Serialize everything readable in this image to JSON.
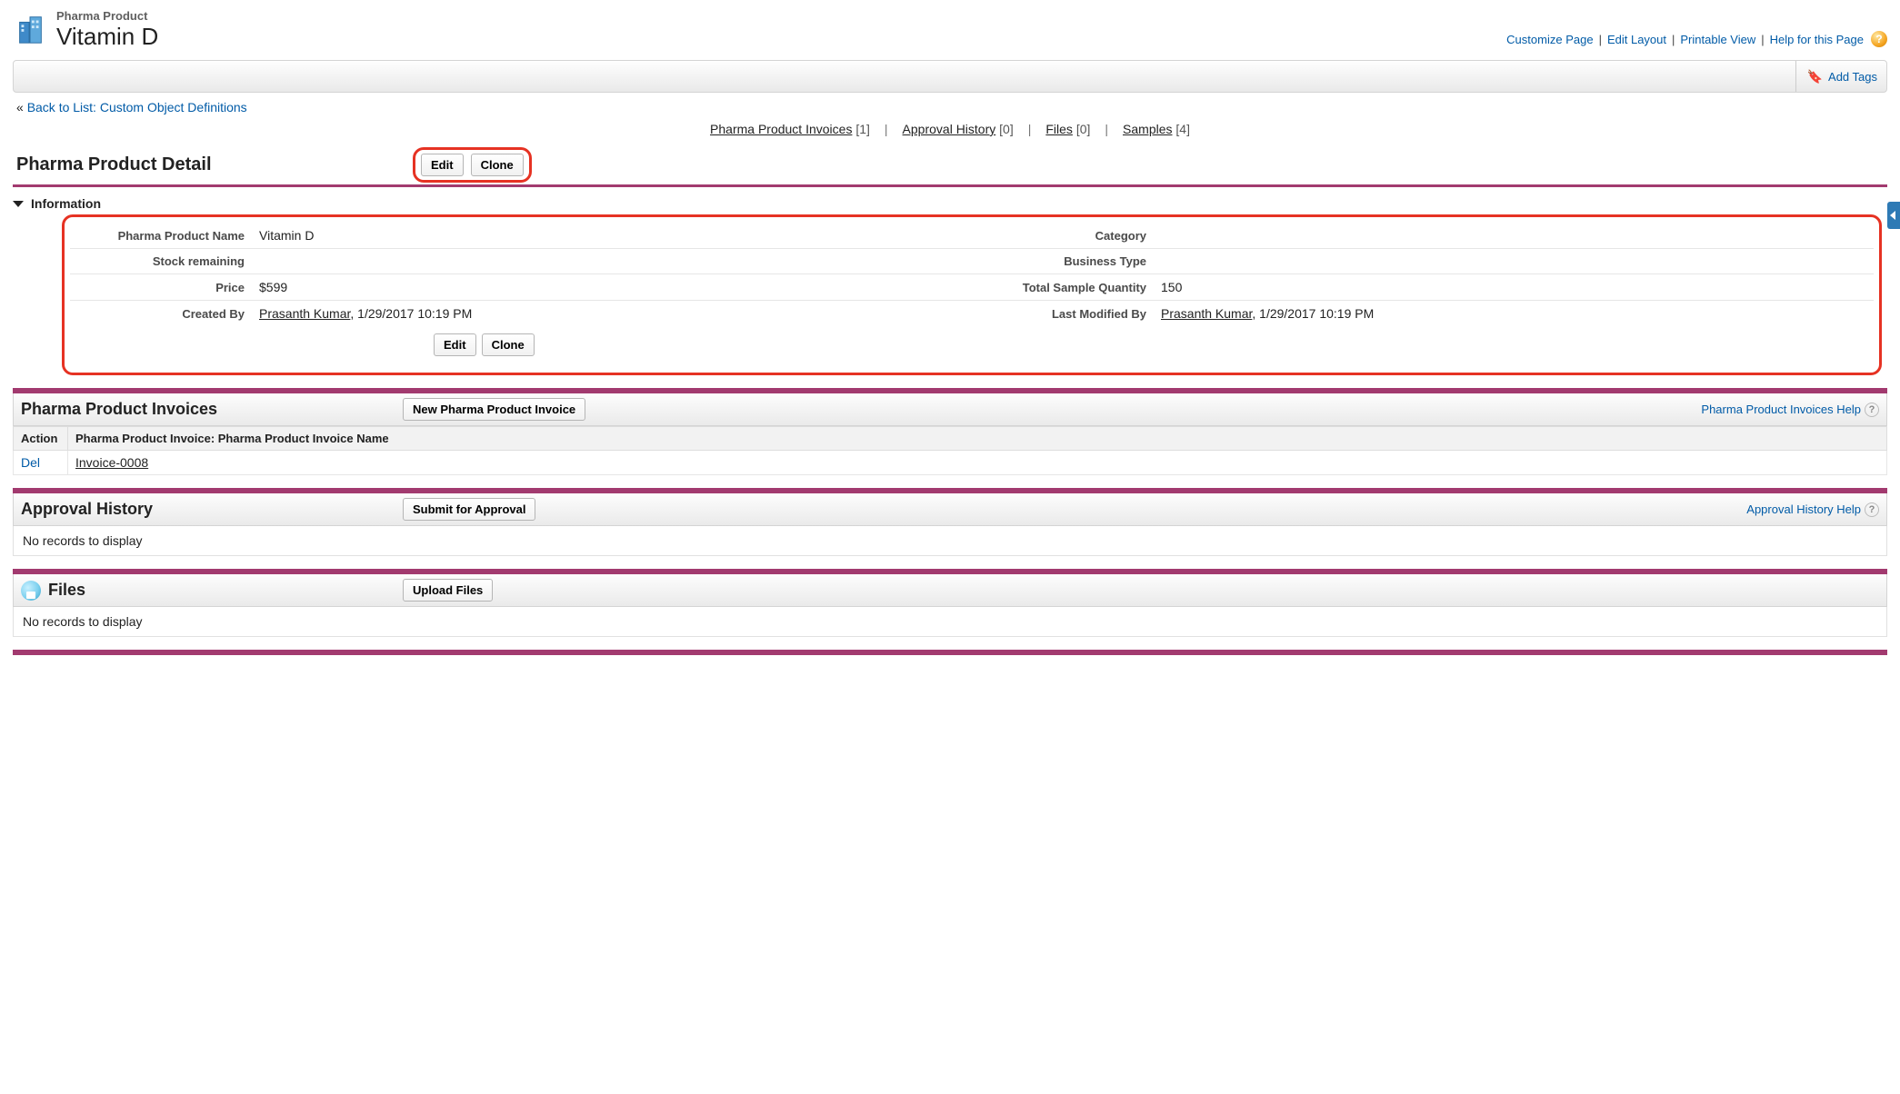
{
  "header": {
    "object_label": "Pharma Product",
    "record_name": "Vitamin D",
    "links": {
      "customize_page": "Customize Page",
      "edit_layout": "Edit Layout",
      "printable_view": "Printable View",
      "help_page": "Help for this Page"
    },
    "add_tags": "Add Tags"
  },
  "back_list": {
    "prefix": "«",
    "label": "Back to List: Custom Object Definitions"
  },
  "related_nav": [
    {
      "label": "Pharma Product Invoices",
      "count": "[1]"
    },
    {
      "label": "Approval History",
      "count": "[0]"
    },
    {
      "label": "Files",
      "count": "[0]"
    },
    {
      "label": "Samples",
      "count": "[4]"
    }
  ],
  "detail": {
    "title": "Pharma Product Detail",
    "btn_edit": "Edit",
    "btn_clone": "Clone",
    "section_title": "Information",
    "fields": {
      "name_label": "Pharma Product Name",
      "name_value": "Vitamin D",
      "category_label": "Category",
      "category_value": "",
      "stock_label": "Stock remaining",
      "stock_value": "",
      "biztype_label": "Business Type",
      "biztype_value": "",
      "price_label": "Price",
      "price_value": "$599",
      "totalqty_label": "Total Sample Quantity",
      "totalqty_value": "150",
      "createdby_label": "Created By",
      "createdby_user": "Prasanth Kumar",
      "createdby_ts": ", 1/29/2017 10:19 PM",
      "modifiedby_label": "Last Modified By",
      "modifiedby_user": "Prasanth Kumar",
      "modifiedby_ts": ", 1/29/2017 10:19 PM"
    }
  },
  "invoices": {
    "title": "Pharma Product Invoices",
    "btn_new": "New Pharma Product Invoice",
    "help_link": "Pharma Product Invoices Help",
    "cols": {
      "action": "Action",
      "name": "Pharma Product Invoice: Pharma Product Invoice Name"
    },
    "rows": [
      {
        "action": "Del",
        "name": "Invoice-0008"
      }
    ]
  },
  "approval": {
    "title": "Approval History",
    "btn_submit": "Submit for Approval",
    "help_link": "Approval History Help",
    "empty": "No records to display"
  },
  "files": {
    "title": "Files",
    "btn_upload": "Upload Files",
    "empty": "No records to display"
  }
}
